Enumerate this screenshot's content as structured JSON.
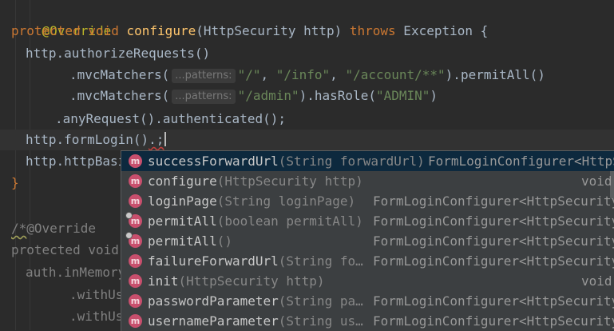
{
  "code": {
    "line1": {
      "annotation": "@Override"
    },
    "line2": {
      "kw1": "protected",
      "kw2": "void",
      "method": "configure",
      "params": "(HttpSecurity http) ",
      "throws": "throws",
      "rest": " Exception {"
    },
    "line3": {
      "text": "http.authorizeRequests()"
    },
    "line4": {
      "prefix": ".mvcMatchers(",
      "hint": "...patterns:",
      "s1": "\"/\"",
      "sep1": ", ",
      "s2": "\"/info\"",
      "sep2": ", ",
      "s3": "\"/account/**\"",
      "suffix": ").permitAll()"
    },
    "line5": {
      "prefix": ".mvcMatchers(",
      "hint": "...patterns:",
      "s1": "\"/admin\"",
      "mid": ").hasRole(",
      "s2": "\"ADMIN\"",
      "suffix": ")"
    },
    "line6": {
      "text": ".anyRequest().authenticated();"
    },
    "line7": {
      "text": "http.formLogin()",
      "tail": ".;"
    },
    "line8": {
      "text": "http.httpBasi"
    },
    "line9": {
      "text": "}"
    },
    "line11": {
      "comment_open": "/*",
      "annotation": "@Override"
    },
    "line12": {
      "kw1": "protected",
      "kw2": "void"
    },
    "line13": {
      "text": "auth.inMemory"
    },
    "line14": {
      "text": ".withUs"
    },
    "line15": {
      "text": ".withUs"
    }
  },
  "completion": {
    "icon_letter": "m",
    "items": [
      {
        "name": "successForwardUrl",
        "params": "(String forwardUrl)",
        "type": "FormLoginConfigurer<HttpSe",
        "selected": true,
        "locked": false
      },
      {
        "name": "configure",
        "params": "(HttpSecurity http)",
        "type": "void",
        "selected": false,
        "locked": false
      },
      {
        "name": "loginPage",
        "params": "(String loginPage)",
        "type": "FormLoginConfigurer<HttpSecurity>",
        "selected": false,
        "locked": false
      },
      {
        "name": "permitAll",
        "params": "(boolean permitAll)",
        "type": "FormLoginConfigurer<HttpSecurity>",
        "selected": false,
        "locked": true
      },
      {
        "name": "permitAll",
        "params": "()",
        "type": "FormLoginConfigurer<HttpSecurity>",
        "selected": false,
        "locked": true
      },
      {
        "name": "failureForwardUrl",
        "params": "(String fo…",
        "type": "FormLoginConfigurer<HttpSecurity>",
        "selected": false,
        "locked": false
      },
      {
        "name": "init",
        "params": "(HttpSecurity http)",
        "type": "void",
        "selected": false,
        "locked": false
      },
      {
        "name": "passwordParameter",
        "params": "(String pa…",
        "type": "FormLoginConfigurer<HttpSecurity>",
        "selected": false,
        "locked": false
      },
      {
        "name": "usernameParameter",
        "params": "(String us…",
        "type": "FormLoginConfigurer<HttpSecurity>",
        "selected": false,
        "locked": false
      }
    ]
  },
  "colors": {
    "background": "#2b2b2b",
    "keyword": "#cc7832",
    "method": "#ffc66d",
    "string": "#6a8759",
    "annotation": "#bbb529",
    "popup_bg": "#3c3f41",
    "popup_selected": "#0d293e",
    "method_icon": "#c84f6d"
  }
}
